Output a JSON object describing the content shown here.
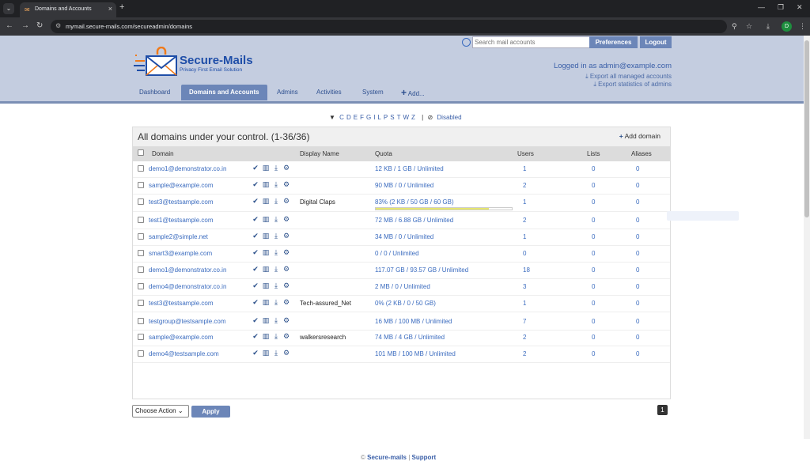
{
  "browser": {
    "tab_title": "Domains and Accounts",
    "url": "mymail.secure-mails.com/secureadmin/domains",
    "profile_initial": "D"
  },
  "header": {
    "search_placeholder": "Search mail accounts",
    "preferences": "Preferences",
    "logout": "Logout",
    "brand": "Secure-Mails",
    "tagline": "Privacy First Email Solution",
    "logged_in": "Logged in as admin@example.com",
    "export_accounts": "Export all managed accounts",
    "export_stats": "Export statistics of admins"
  },
  "nav": {
    "dashboard": "Dashboard",
    "domains": "Domains and Accounts",
    "admins": "Admins",
    "activities": "Activities",
    "system": "System",
    "add": "Add..."
  },
  "filter": {
    "letters": [
      "C",
      "D",
      "E",
      "F",
      "G",
      "I",
      "L",
      "P",
      "S",
      "T",
      "W",
      "Z"
    ],
    "separator": "|",
    "disabled": "Disabled"
  },
  "panel": {
    "title": "All domains under your control. (1-36/36)",
    "add_domain": "Add domain",
    "columns": {
      "domain": "Domain",
      "display_name": "Display Name",
      "quota": "Quota",
      "users": "Users",
      "lists": "Lists",
      "aliases": "Aliases"
    },
    "rows": [
      {
        "domain": "demo1@demonstrator.co.in",
        "display": "",
        "quota": "12 KB / 1 GB / Unlimited",
        "users": "1",
        "lists": "0",
        "aliases": "0"
      },
      {
        "domain": "sample@example.com",
        "display": "",
        "quota": "90 MB / 0 / Unlimited",
        "users": "2",
        "lists": "0",
        "aliases": "0"
      },
      {
        "domain": "test3@testsample.com",
        "display": "Digital Claps",
        "quota": "83% (2 KB / 50 GB / 60 GB)",
        "users": "1",
        "lists": "0",
        "aliases": "0",
        "usage": 0.83
      },
      {
        "domain": "test1@testsample.com",
        "display": "",
        "quota": "72 MB / 6.88 GB / Unlimited",
        "users": "2",
        "lists": "0",
        "aliases": "0"
      },
      {
        "domain": "sample2@simple.net",
        "display": "",
        "quota": "34 MB / 0 / Unlimited",
        "users": "1",
        "lists": "0",
        "aliases": "0"
      },
      {
        "domain": "smart3@example.com",
        "display": "",
        "quota": "0 / 0 / Unlimited",
        "users": "0",
        "lists": "0",
        "aliases": "0"
      },
      {
        "domain": "demo1@demonstrator.co.in",
        "display": "",
        "quota": "117.07 GB / 93.57 GB / Unlimited",
        "users": "18",
        "lists": "0",
        "aliases": "0"
      },
      {
        "domain": "demo4@demonstrator.co.in",
        "display": "",
        "quota": "2 MB / 0 / Unlimited",
        "users": "3",
        "lists": "0",
        "aliases": "0"
      },
      {
        "domain": "test3@testsample.com",
        "display": "Tech-assured_Net",
        "quota": "0% (2 KB / 0 / 50 GB)",
        "users": "1",
        "lists": "0",
        "aliases": "0"
      },
      {
        "domain": "testgroup@testsample.com",
        "display": "",
        "quota": "16 MB / 100 MB / Unlimited",
        "users": "7",
        "lists": "0",
        "aliases": "0"
      },
      {
        "domain": "sample@example.com",
        "display": "walkersresearch",
        "quota": "74 MB / 4 GB / Unlimited",
        "users": "2",
        "lists": "0",
        "aliases": "0"
      },
      {
        "domain": "demo4@testsample.com",
        "display": "",
        "quota": "101 MB / 100 MB / Unlimited",
        "users": "2",
        "lists": "0",
        "aliases": "0"
      }
    ]
  },
  "actions": {
    "choose": "Choose Action",
    "apply": "Apply",
    "page": "1"
  },
  "footer": {
    "copyright": "©",
    "brand": "Secure-mails",
    "separator": "|",
    "support": "Support"
  }
}
